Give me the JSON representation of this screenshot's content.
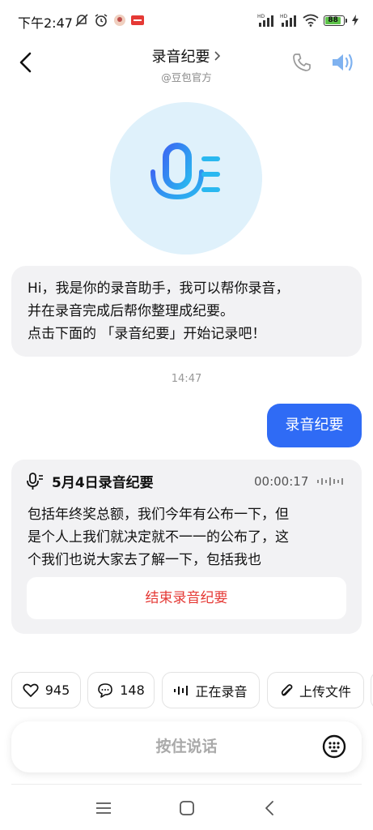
{
  "status_bar": {
    "time": "下午2:47",
    "battery": "88",
    "network_1": "HD",
    "network_2": "HD"
  },
  "header": {
    "title": "录音纪要",
    "subtitle": "@豆包官方"
  },
  "chat": {
    "greeting_lines": [
      "Hi，我是你的录音助手，我可以帮你录音，",
      "并在录音完成后帮你整理成纪要。",
      "点击下面的 「录音纪要」开始记录吧！"
    ],
    "timestamp": "14:47",
    "user_message": "录音纪要"
  },
  "recording_card": {
    "title": "5月4日录音纪要",
    "timer": "00:00:17",
    "transcript_lines": [
      "包括年终奖总额，我们今年有公布一下，但",
      "是个人上我们就决定就不一一的公布了，这",
      "个我们也说大家去了解一下，包括我也"
    ],
    "stop_label": "结束录音纪要"
  },
  "actions": {
    "likes": "945",
    "comments": "148",
    "recording_label": "正在录音",
    "upload_label": "上传文件"
  },
  "input": {
    "hold_to_talk": "按住说话"
  },
  "colors": {
    "accent_blue": "#2f6bf5",
    "stop_red": "#e53935",
    "bubble_gray": "#f2f2f4",
    "avatar_bg": "#dff1fb",
    "battery_green": "#5ec44a"
  },
  "icons": [
    "mute-icon",
    "alarm-icon",
    "signal-icon",
    "wifi-icon",
    "battery-icon",
    "back-icon",
    "chevron-right-icon",
    "phone-icon",
    "speaker-icon",
    "mic-icon",
    "waveform-icon",
    "heart-icon",
    "comment-icon",
    "paperclip-icon",
    "keyboard-icon",
    "menu-icon",
    "home-icon",
    "nav-back-icon"
  ]
}
